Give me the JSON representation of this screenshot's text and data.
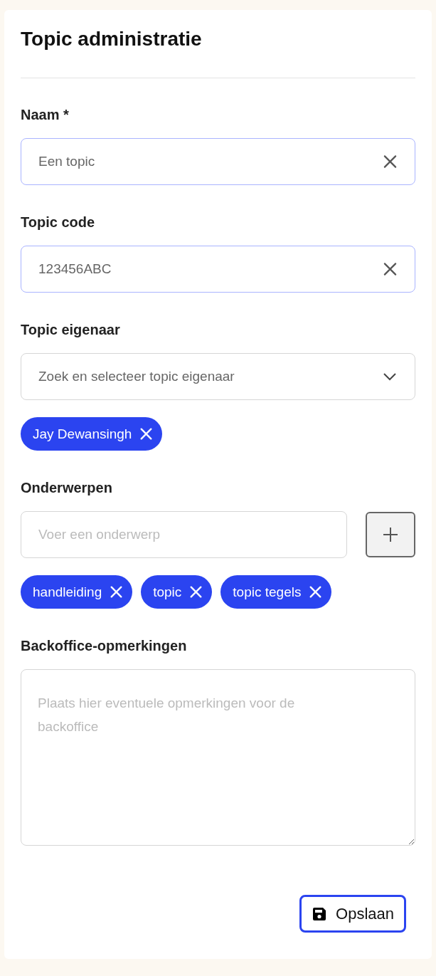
{
  "title": "Topic administratie",
  "fields": [
    {
      "kind": "text",
      "label": "Naam *",
      "value": "Een topic"
    },
    {
      "kind": "text",
      "label": "Topic code",
      "value": "123456ABC"
    },
    {
      "kind": "select",
      "label": "Topic eigenaar",
      "placeholder": "Zoek en selecteer topic eigenaar",
      "chips": [
        "Jay Dewansingh"
      ]
    },
    {
      "kind": "tags",
      "label": "Onderwerpen",
      "placeholder": "Voer een onderwerp",
      "chips": [
        "handleiding",
        "topic",
        "topic tegels"
      ]
    },
    {
      "kind": "textarea",
      "label": "Backoffice-opmerkingen",
      "placeholder": "Plaats hier eventuele opmerkingen voor de backoffice"
    }
  ],
  "save_button": {
    "label": "Opslaan"
  }
}
